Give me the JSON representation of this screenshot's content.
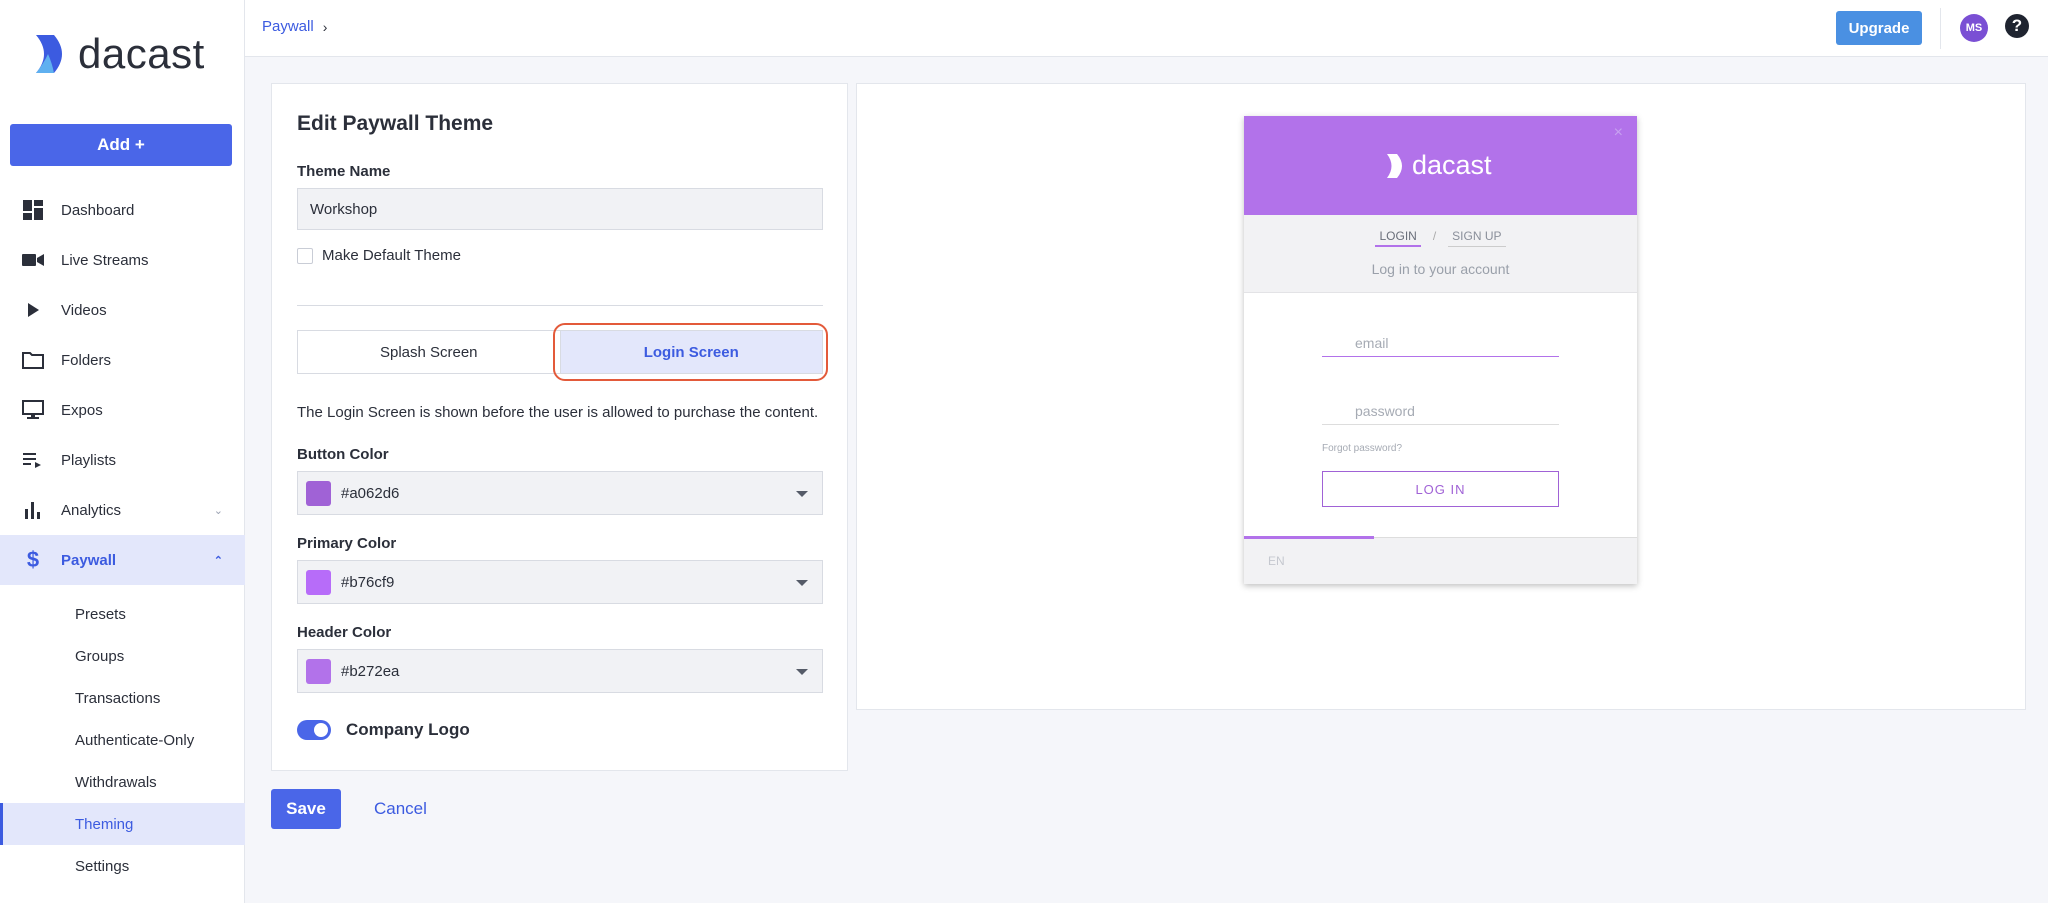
{
  "brand": {
    "name": "dacast"
  },
  "sidebar": {
    "add_label": "Add +",
    "items": [
      {
        "label": "Dashboard",
        "icon": "dashboard-icon"
      },
      {
        "label": "Live Streams",
        "icon": "video-camera-icon"
      },
      {
        "label": "Videos",
        "icon": "play-icon"
      },
      {
        "label": "Folders",
        "icon": "folder-icon"
      },
      {
        "label": "Expos",
        "icon": "monitor-icon"
      },
      {
        "label": "Playlists",
        "icon": "playlist-icon"
      },
      {
        "label": "Analytics",
        "icon": "bar-chart-icon"
      },
      {
        "label": "Paywall",
        "icon": "dollar-icon"
      }
    ],
    "paywall_sub": [
      "Presets",
      "Groups",
      "Transactions",
      "Authenticate-Only",
      "Withdrawals",
      "Theming",
      "Settings"
    ]
  },
  "topbar": {
    "breadcrumb": "Paywall",
    "breadcrumb_sep": "›",
    "upgrade_label": "Upgrade",
    "avatar_initials": "MS",
    "help_label": "?"
  },
  "edit": {
    "title": "Edit Paywall Theme",
    "theme_name_label": "Theme Name",
    "theme_name_value": "Workshop",
    "default_label": "Make Default Theme",
    "tab_splash": "Splash Screen",
    "tab_login": "Login Screen",
    "description": "The Login Screen is shown before the user is allowed to purchase the content.",
    "button_color_label": "Button Color",
    "button_color": "#a062d6",
    "primary_color_label": "Primary Color",
    "primary_color": "#b76cf9",
    "header_color_label": "Header Color",
    "header_color": "#b272ea",
    "company_logo_label": "Company Logo",
    "company_logo_on": true,
    "save_label": "Save",
    "cancel_label": "Cancel"
  },
  "preview": {
    "logo_text": "dacast",
    "close": "×",
    "tab_login": "LOGIN",
    "tab_sep": "/",
    "tab_signup": "SIGN UP",
    "subtitle": "Log in to your account",
    "email_placeholder": "email",
    "password_placeholder": "password",
    "forgot": "Forgot password?",
    "login_button": "LOG IN",
    "lang": "EN"
  },
  "colors": {
    "accent": "#4a66e8",
    "upgrade": "#4a90e2",
    "highlight": "#e35a3a"
  }
}
